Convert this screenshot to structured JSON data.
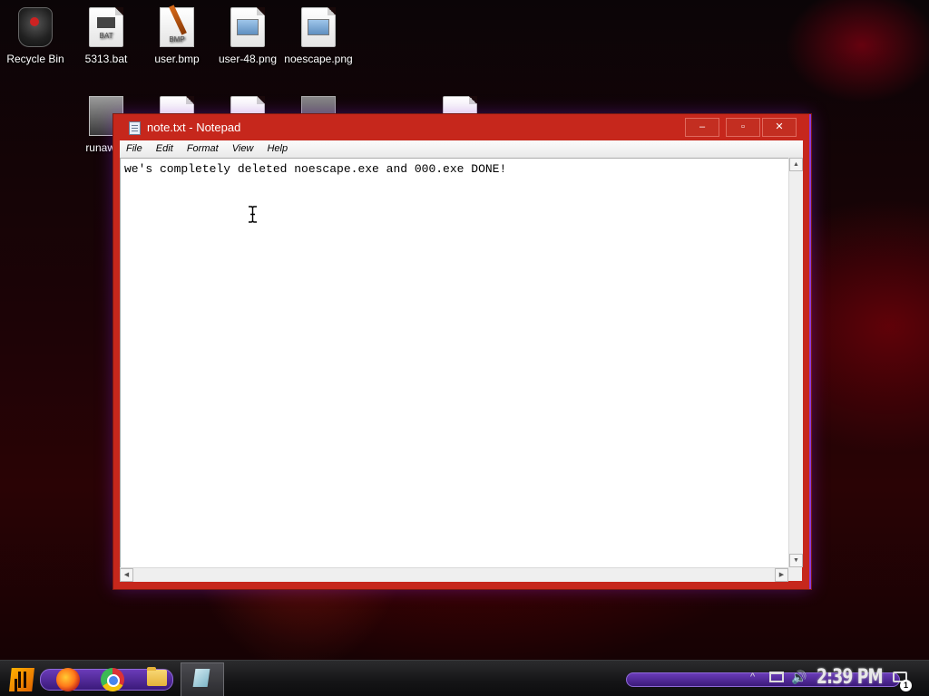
{
  "desktop": {
    "icons_row1": [
      {
        "label": "Recycle Bin",
        "icon": "recycle-bin-icon"
      },
      {
        "label": "5313.bat",
        "icon": "bat-file-icon",
        "tag": "BAT"
      },
      {
        "label": "user.bmp",
        "icon": "bmp-file-icon",
        "tag": "BMP"
      },
      {
        "label": "user-48.png",
        "icon": "image-file-icon"
      },
      {
        "label": "noescape.png",
        "icon": "image-file-icon"
      }
    ],
    "icons_row2": [
      {
        "label": "runaway",
        "icon": "app-icon"
      }
    ]
  },
  "notepad": {
    "title": "note.txt - Notepad",
    "buttons": {
      "minimize": "–",
      "maximize": "▫",
      "close": "✕"
    },
    "menu": [
      "File",
      "Edit",
      "Format",
      "View",
      "Help"
    ],
    "content": "we's completely deleted noescape.exe and 000.exe DONE!"
  },
  "taskbar": {
    "apps": [
      "start-icon",
      "firefox-icon",
      "chrome-icon",
      "file-explorer-icon",
      "notepad-icon"
    ],
    "tray": {
      "chevron": "^",
      "volume": "🔊"
    },
    "clock": "2:39 PM",
    "notifications_count": "1"
  },
  "colors": {
    "window_frame": "#c6271c",
    "accent_purple": "#8f3ad8"
  }
}
